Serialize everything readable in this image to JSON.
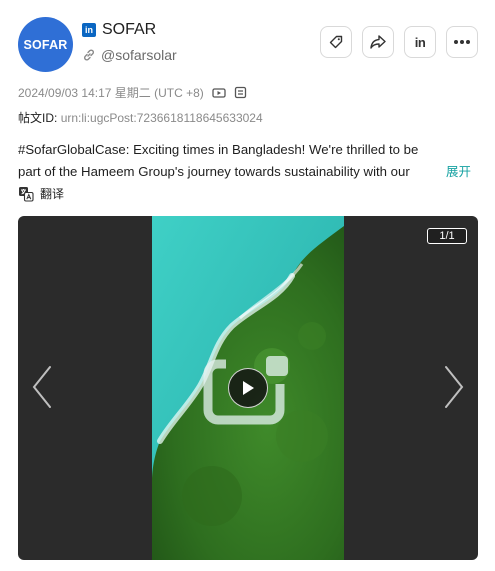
{
  "account": {
    "logo_text": "SOFAR",
    "platform_badge": "in",
    "name": "SOFAR",
    "handle": "@sofarsolar"
  },
  "actions": {
    "linkedin_label": "in"
  },
  "meta": {
    "datetime": "2024/09/03 14:17 星期二 (UTC +8)"
  },
  "post_id": {
    "label": "帖文ID:",
    "value": "urn:li:ugcPost:7236618118645633024"
  },
  "post": {
    "line1": "#SofarGlobalCase: Exciting times in Bangladesh! We're thrilled to be",
    "line2": "part of the Hameem Group's journey towards sustainability with our",
    "expand_label": "展开"
  },
  "translate": {
    "label": "翻译"
  },
  "media": {
    "counter": "1/1"
  },
  "colors": {
    "avatar_bg": "#2f6fd6",
    "linkedin_blue": "#0a66c2",
    "expand_link": "#17a2a2",
    "media_bg": "#2b2b2b"
  },
  "icons": [
    "linkedin-badge-icon",
    "link-icon",
    "tag-icon",
    "share-icon",
    "linkedin-icon",
    "more-icon",
    "video-icon",
    "image-icon",
    "translate-icon",
    "chevron-left-icon",
    "chevron-right-icon",
    "play-icon"
  ]
}
